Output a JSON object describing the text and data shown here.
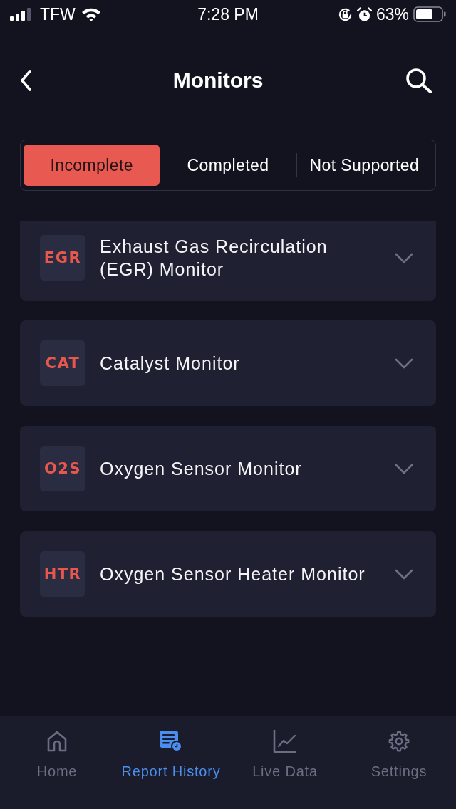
{
  "status_bar": {
    "carrier": "TFW",
    "time": "7:28 PM",
    "battery": "63%"
  },
  "header": {
    "title": "Monitors"
  },
  "tabs": [
    {
      "label": "Incomplete",
      "selected": true
    },
    {
      "label": "Completed",
      "selected": false
    },
    {
      "label": "Not Supported",
      "selected": false
    }
  ],
  "monitors": [
    {
      "code": "EGR",
      "name": "Exhaust Gas Recirculation (EGR) Monitor",
      "expanded": false
    },
    {
      "code": "CAT",
      "name": "Catalyst Monitor",
      "expanded": false
    },
    {
      "code": "O2S",
      "name": "Oxygen Sensor Monitor",
      "expanded": false
    },
    {
      "code": "HTR",
      "name": "Oxygen Sensor Heater Monitor",
      "expanded": false
    }
  ],
  "bottom_nav": [
    {
      "label": "Home",
      "selected": false
    },
    {
      "label": "Report History",
      "selected": true
    },
    {
      "label": "Live Data",
      "selected": false
    },
    {
      "label": "Settings",
      "selected": false
    }
  ]
}
